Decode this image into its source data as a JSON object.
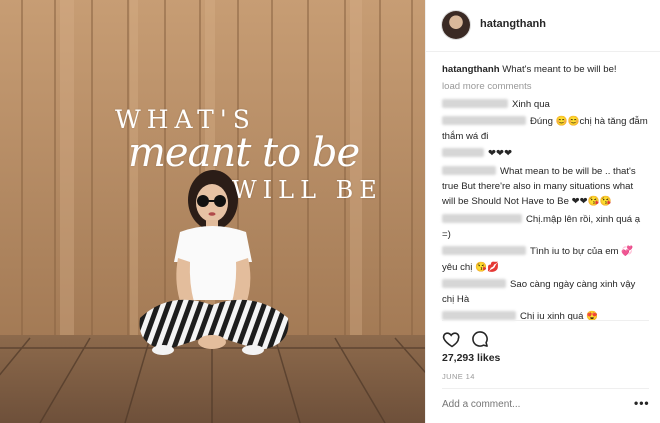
{
  "photo": {
    "overlay": [
      "WHAT'S",
      "meant to be",
      "WILL BE"
    ]
  },
  "header": {
    "username": "hatangthanh"
  },
  "caption": {
    "username": "hatangthanh",
    "text": "What's meant to be will be!"
  },
  "load_more": "load more comments",
  "comments": [
    {
      "text": "Xinh qua"
    },
    {
      "text": "Đúng 😊😊chị hà tăng đẫm thắm wá đi"
    },
    {
      "text": "❤❤❤"
    },
    {
      "text": "What mean to be will be .. that's true But there're also in many situations what will be Should Not Have to Be ❤❤😘😘"
    },
    {
      "text": "Chị.mập lên rồi, xinh quá ạ =)"
    },
    {
      "text": "Tình iu to bự của em 💞 yêu chị 😘💋"
    },
    {
      "text": "Sao càng ngày càng xinh vậy chị Hà"
    },
    {
      "text": "Chị iu xinh quá 😍"
    }
  ],
  "likes": "27,293 likes",
  "date": "JUNE 14",
  "add_comment_placeholder": "Add a comment...",
  "more_options": "•••"
}
